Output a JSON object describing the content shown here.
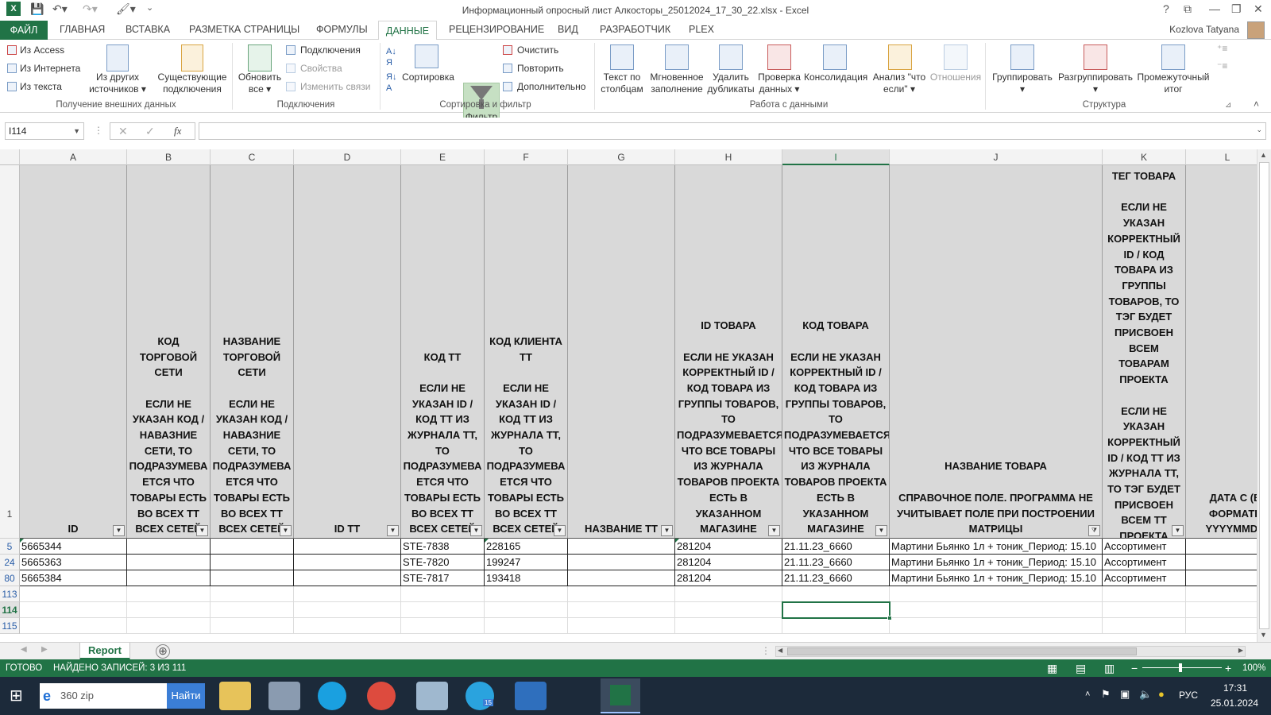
{
  "window": {
    "title": "Информационный опросный лист Алкосторы_25012024_17_30_22.xlsx - Excel",
    "help": "?",
    "user": "Kozlova Tatyana"
  },
  "tabs": {
    "file": "ФАЙЛ",
    "items": [
      "ГЛАВНАЯ",
      "ВСТАВКА",
      "РАЗМЕТКА СТРАНИЦЫ",
      "ФОРМУЛЫ"
    ],
    "active": "ДАННЫЕ",
    "items_after": [
      "РЕЦЕНЗИРОВАНИЕ",
      "ВИД",
      "РАЗРАБОТЧИК",
      "PLEX"
    ]
  },
  "ribbon": {
    "ext": {
      "access": "Из Access",
      "web": "Из Интернета",
      "text": "Из текста",
      "other1": "Из других",
      "other2": "источников",
      "existing1": "Существующие",
      "existing2": "подключения",
      "group": "Получение внешних данных"
    },
    "conn": {
      "refresh1": "Обновить",
      "refresh2": "все",
      "connections": "Подключения",
      "properties": "Свойства",
      "edit_links": "Изменить связи",
      "group": "Подключения"
    },
    "sort": {
      "sort": "Сортировка",
      "filter": "Фильтр",
      "clear": "Очистить",
      "reapply": "Повторить",
      "advanced": "Дополнительно",
      "group": "Сортировка и фильтр"
    },
    "tools": {
      "text_cols1": "Текст по",
      "text_cols2": "столбцам",
      "flash1": "Мгновенное",
      "flash2": "заполнение",
      "dup1": "Удалить",
      "dup2": "дубликаты",
      "valid1": "Проверка",
      "valid2": "данных",
      "consol": "Консолидация",
      "whatif1": "Анализ \"что",
      "whatif2": "если\"",
      "relations": "Отношения",
      "group": "Работа с данными"
    },
    "outline": {
      "group_btn": "Группировать",
      "ungroup": "Разгруппировать",
      "subtotal1": "Промежуточный",
      "subtotal2": "итог",
      "group": "Структура"
    }
  },
  "formula_bar": {
    "name_box": "I114",
    "fx": "fx",
    "formula": ""
  },
  "columns": [
    "A",
    "B",
    "C",
    "D",
    "E",
    "F",
    "G",
    "H",
    "I",
    "J",
    "K",
    "L"
  ],
  "headers": {
    "A": "ID",
    "B": "КОД ТОРГОВОЙ СЕТИ\n\nЕСЛИ НЕ УКАЗАН КОД / НАВАЗНИЕ СЕТИ, ТО ПОДРАЗУМЕВА ЕТСЯ ЧТО ТОВАРЫ ЕСТЬ ВО ВСЕХ ТТ ВСЕХ СЕТЕЙ",
    "C": "НАЗВАНИЕ ТОРГОВОЙ СЕТИ\n\nЕСЛИ НЕ УКАЗАН КОД / НАВАЗНИЕ СЕТИ, ТО ПОДРАЗУМЕВА ЕТСЯ ЧТО ТОВАРЫ ЕСТЬ ВО ВСЕХ ТТ ВСЕХ СЕТЕЙ",
    "D": "ID ТТ",
    "E": "КОД ТТ\n\nЕСЛИ НЕ УКАЗАН ID / КОД ТТ ИЗ ЖУРНАЛА ТТ, ТО ПОДРАЗУМЕВА ЕТСЯ ЧТО ТОВАРЫ ЕСТЬ ВО ВСЕХ ТТ ВСЕХ СЕТЕЙ",
    "F": "КОД КЛИЕНТА ТТ\n\nЕСЛИ НЕ УКАЗАН ID / КОД ТТ ИЗ ЖУРНАЛА ТТ, ТО ПОДРАЗУМЕВА ЕТСЯ ЧТО ТОВАРЫ ЕСТЬ ВО ВСЕХ ТТ ВСЕХ СЕТЕЙ",
    "G": "НАЗВАНИЕ ТТ",
    "H": "ID ТОВАРА\n\nЕСЛИ НЕ УКАЗАН КОРРЕКТНЫЙ ID / КОД ТОВАРА ИЗ ГРУППЫ ТОВАРОВ, ТО ПОДРАЗУМЕВАЕТСЯ ЧТО ВСЕ ТОВАРЫ ИЗ ЖУРНАЛА ТОВАРОВ ПРОЕКТА ЕСТЬ В УКАЗАННОМ МАГАЗИНЕ",
    "I": "КОД ТОВАРА\n\nЕСЛИ НЕ УКАЗАН КОРРЕКТНЫЙ ID / КОД ТОВАРА ИЗ ГРУППЫ ТОВАРОВ, ТО ПОДРАЗУМЕВАЕТСЯ ЧТО ВСЕ ТОВАРЫ ИЗ ЖУРНАЛА ТОВАРОВ ПРОЕКТА ЕСТЬ В УКАЗАННОМ МАГАЗИНЕ",
    "J": "НАЗВАНИЕ ТОВАРА\n\nСПРАВОЧНОЕ ПОЛЕ. ПРОГРАММА НЕ УЧИТЫВАЕТ ПОЛЕ ПРИ ПОСТРОЕНИИ МАТРИЦЫ",
    "K": "ТЕГ ТОВАРА\n\nЕСЛИ НЕ УКАЗАН КОРРЕКТНЫЙ ID / КОД ТОВАРА ИЗ ГРУППЫ ТОВАРОВ, ТО ТЭГ БУДЕТ ПРИСВОЕН ВСЕМ ТОВАРАМ ПРОЕКТА\n\nЕСЛИ НЕ УКАЗАН КОРРЕКТНЫЙ ID / КОД ТТ ИЗ ЖУРНАЛА ТТ, ТО ТЭГ БУДЕТ ПРИСВОЕН ВСЕМ ТТ ПРОЕКТА",
    "L": "ДАТА С (В ФОРМАТЕ YYYYMMDD"
  },
  "rows": [
    {
      "num": "5",
      "A": "5665344",
      "E": "STE-7838",
      "F": "228165",
      "H": "281204",
      "I": "21.11.23_6660",
      "J": "Мартини Бьянко 1л + тоник_Период: 15.10",
      "K": "Ассортимент"
    },
    {
      "num": "24",
      "A": "5665363",
      "E": "STE-7820",
      "F": "199247",
      "H": "281204",
      "I": "21.11.23_6660",
      "J": "Мартини Бьянко 1л + тоник_Период: 15.10",
      "K": "Ассортимент"
    },
    {
      "num": "80",
      "A": "5665384",
      "E": "STE-7817",
      "F": "193418",
      "H": "281204",
      "I": "21.11.23_6660",
      "J": "Мартини Бьянко 1л + тоник_Период: 15.10",
      "K": "Ассортимент"
    }
  ],
  "row_numbers": {
    "header": "1",
    "empty": [
      "113",
      "114",
      "115"
    ]
  },
  "sheet": {
    "tab": "Report",
    "add": "⊕"
  },
  "status": {
    "ready": "ГОТОВО",
    "found": "НАЙДЕНО ЗАПИСЕЙ: 3 ИЗ 111",
    "zoom": "100%"
  },
  "taskbar": {
    "search": "360 zip",
    "search_btn": "Найти",
    "lang": "РУС",
    "time": "17:31",
    "date": "25.01.2024",
    "telegram_badge": "15"
  }
}
